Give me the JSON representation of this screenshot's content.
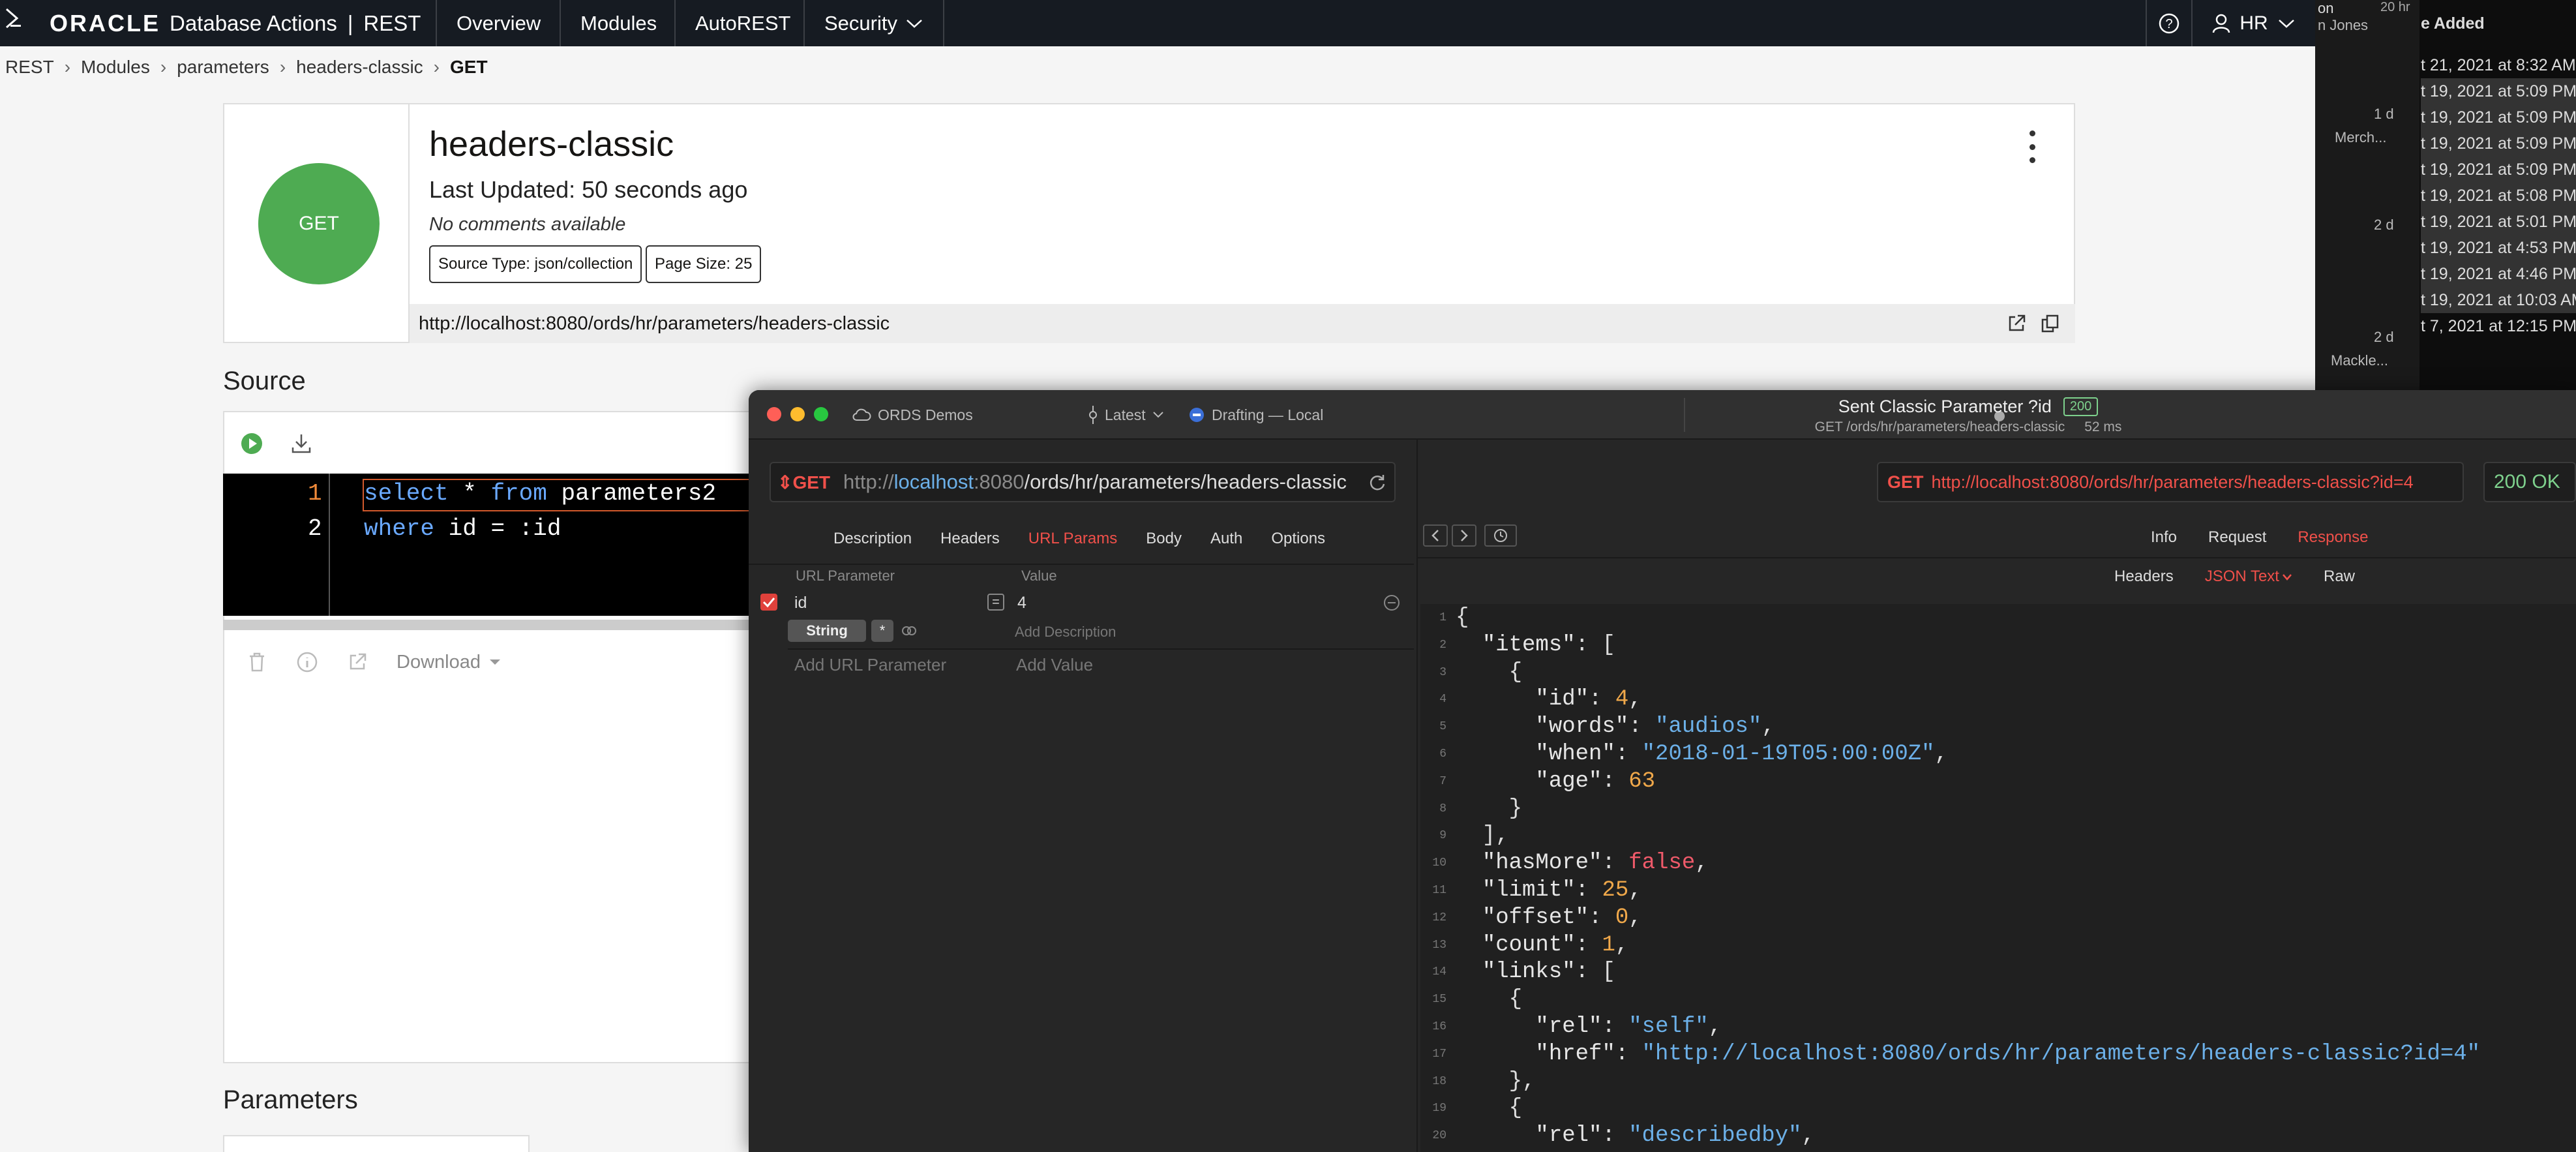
{
  "topbar": {
    "logo": "ORACLE",
    "app": "Database Actions",
    "sep": "|",
    "section": "REST",
    "nav": [
      "Overview",
      "Modules",
      "AutoREST",
      "Security"
    ],
    "user": "HR"
  },
  "breadcrumb": [
    "REST",
    "Modules",
    "parameters",
    "headers-classic",
    "GET"
  ],
  "handler": {
    "method": "GET",
    "title": "headers-classic",
    "updated": "Last Updated: 50 seconds ago",
    "comment": "No comments available",
    "source_type": "Source Type: json/collection",
    "page_size": "Page Size: 25",
    "url": "http://localhost:8080/ords/hr/parameters/headers-classic"
  },
  "source": {
    "label": "Source",
    "lines": [
      {
        "num": "1",
        "a": "select",
        "b": " * ",
        "c": "from",
        "d": " parameters2"
      },
      {
        "num": "2",
        "a": "where",
        "b": " id = :id",
        "c": "",
        "d": ""
      }
    ],
    "download": "Download"
  },
  "parameters_label": "Parameters",
  "bg_app": {
    "header_left": "on",
    "header_time": "20 hr",
    "header_col": "e Added",
    "name": "n Jones",
    "left_items": [
      "1 d",
      "Merch...",
      "2 d",
      "2 d",
      "Mackle..."
    ],
    "rows": [
      "t 21, 2021 at 8:32 AM",
      "t 19, 2021 at 5:09 PM",
      "t 19, 2021 at 5:09 PM",
      "t 19, 2021 at 5:09 PM",
      "t 19, 2021 at 5:09 PM",
      "t 19, 2021 at 5:08 PM",
      "t 19, 2021 at 5:01 PM",
      "t 19, 2021 at 4:53 PM",
      "t 19, 2021 at 4:46 PM",
      "t 19, 2021 at 10:03 AM",
      "t 7, 2021 at 12:15 PM"
    ]
  },
  "paw": {
    "workspace": "ORDS Demos",
    "version": "Latest",
    "env": "Drafting — Local",
    "title": "Sent Classic Parameter ?id",
    "status_badge": "200",
    "subtitle": "GET /ords/hr/parameters/headers-classic",
    "time": "52 ms",
    "method": "GET",
    "url_prefix": "http://",
    "url_host": "localhost",
    "url_port": ":8080",
    "url_path": "/ords/hr/parameters/headers-classic",
    "req_tabs": [
      "Description",
      "Headers",
      "URL Params",
      "Body",
      "Auth",
      "Options"
    ],
    "param_headers": [
      "URL Parameter",
      "Value"
    ],
    "param": {
      "name": "id",
      "value": "4",
      "type": "String",
      "desc_placeholder": "Add Description"
    },
    "add_param": "Add URL Parameter",
    "add_value": "Add Value",
    "resp_method": "GET",
    "resp_url": "http://localhost:8080/ords/hr/parameters/headers-classic?id=4",
    "resp_status": "200 OK",
    "resp_tabs": [
      "Info",
      "Request",
      "Response"
    ],
    "resp_subtabs": [
      "Headers",
      "JSON Text",
      "Raw"
    ],
    "json_lines": [
      [
        "1",
        "{"
      ],
      [
        "2",
        "  \"items\": ["
      ],
      [
        "3",
        "    {"
      ],
      [
        "4",
        "      \"id\": 4,"
      ],
      [
        "5",
        "      \"words\": \"audios\","
      ],
      [
        "6",
        "      \"when\": \"2018-01-19T05:00:00Z\","
      ],
      [
        "7",
        "      \"age\": 63"
      ],
      [
        "8",
        "    }"
      ],
      [
        "9",
        "  ],"
      ],
      [
        "10",
        "  \"hasMore\": false,"
      ],
      [
        "11",
        "  \"limit\": 25,"
      ],
      [
        "12",
        "  \"offset\": 0,"
      ],
      [
        "13",
        "  \"count\": 1,"
      ],
      [
        "14",
        "  \"links\": ["
      ],
      [
        "15",
        "    {"
      ],
      [
        "16",
        "      \"rel\": \"self\","
      ],
      [
        "17",
        "      \"href\": \"http://localhost:8080/ords/hr/parameters/headers-classic?id=4\""
      ],
      [
        "18",
        "    },"
      ],
      [
        "19",
        "    {"
      ],
      [
        "20",
        "      \"rel\": \"describedby\","
      ]
    ]
  }
}
